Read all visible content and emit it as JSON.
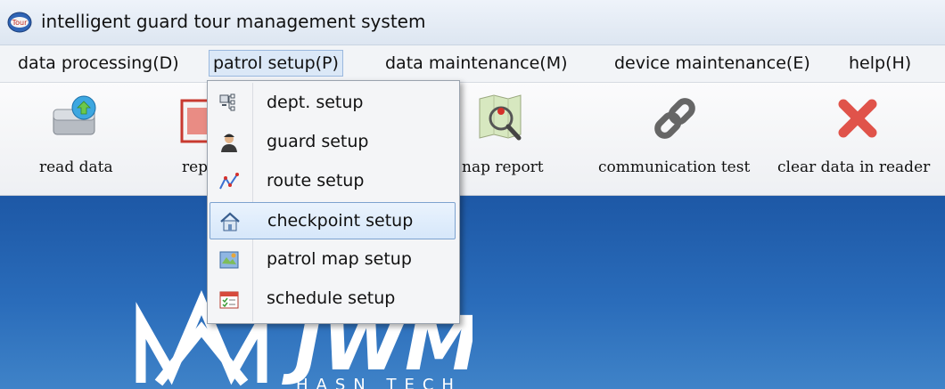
{
  "window": {
    "title": "intelligent guard tour management system",
    "app_icon_text": "Tour"
  },
  "menubar": {
    "items": [
      {
        "label": "data processing(D)"
      },
      {
        "label": "patrol setup(P)"
      },
      {
        "label": "data maintenance(M)"
      },
      {
        "label": "device maintenance(E)"
      },
      {
        "label": "help(H)"
      }
    ]
  },
  "toolbar": {
    "items": [
      {
        "label": "read data",
        "icon": "read-data-icon"
      },
      {
        "label": "rep",
        "icon": "report-icon"
      },
      {
        "label": "nap report",
        "icon": "map-report-icon"
      },
      {
        "label": "communication test",
        "icon": "link-icon"
      },
      {
        "label": "clear data in reader",
        "icon": "red-x-icon"
      }
    ]
  },
  "dropdown": {
    "items": [
      {
        "label": "dept. setup",
        "icon": "department-icon"
      },
      {
        "label": "guard setup",
        "icon": "guard-icon"
      },
      {
        "label": "route setup",
        "icon": "route-icon"
      },
      {
        "label": "checkpoint setup",
        "icon": "house-icon"
      },
      {
        "label": "patrol map setup",
        "icon": "map-icon"
      },
      {
        "label": "schedule setup",
        "icon": "calendar-icon"
      }
    ],
    "highlighted_index": 3
  },
  "logo": {
    "text": "JWM",
    "subtext": "HASN TECH"
  },
  "colors": {
    "main_background": "#2a6cba",
    "highlight_border": "#7da2ce",
    "clear_icon": "#e0534a"
  }
}
